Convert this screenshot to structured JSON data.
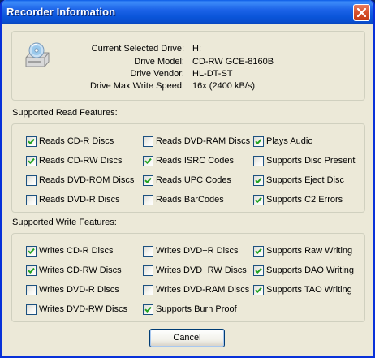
{
  "window": {
    "title": "Recorder Information"
  },
  "drive_info": [
    {
      "label": "Current Selected Drive:",
      "value": "H:"
    },
    {
      "label": "Drive Model:",
      "value": "CD-RW GCE-8160B"
    },
    {
      "label": "Drive Vendor:",
      "value": "HL-DT-ST"
    },
    {
      "label": "Drive Max Write Speed:",
      "value": "16x (2400 kB/s)"
    }
  ],
  "read_section": {
    "label": "Supported Read Features:",
    "items": [
      {
        "label": "Reads CD-R Discs",
        "checked": true
      },
      {
        "label": "Reads CD-RW Discs",
        "checked": true
      },
      {
        "label": "Reads DVD-ROM Discs",
        "checked": false
      },
      {
        "label": "Reads DVD-R Discs",
        "checked": false
      },
      {
        "label": "Reads DVD-RAM Discs",
        "checked": false
      },
      {
        "label": "Reads ISRC Codes",
        "checked": true
      },
      {
        "label": "Reads UPC Codes",
        "checked": true
      },
      {
        "label": "Reads BarCodes",
        "checked": false
      },
      {
        "label": "Plays Audio",
        "checked": true
      },
      {
        "label": "Supports Disc Present",
        "checked": false
      },
      {
        "label": "Supports Eject Disc",
        "checked": true
      },
      {
        "label": "Supports C2 Errors",
        "checked": true
      }
    ]
  },
  "write_section": {
    "label": "Supported Write Features:",
    "items": [
      {
        "label": "Writes CD-R Discs",
        "checked": true
      },
      {
        "label": "Writes CD-RW Discs",
        "checked": true
      },
      {
        "label": "Writes DVD-R Discs",
        "checked": false
      },
      {
        "label": "Writes DVD-RW Discs",
        "checked": false
      },
      {
        "label": "Writes DVD+R Discs",
        "checked": false
      },
      {
        "label": "Writes DVD+RW Discs",
        "checked": false
      },
      {
        "label": "Writes DVD-RAM Discs",
        "checked": false
      },
      {
        "label": "Supports Burn Proof",
        "checked": true
      },
      {
        "label": "Supports Raw Writing",
        "checked": true
      },
      {
        "label": "Supports DAO Writing",
        "checked": true
      },
      {
        "label": "Supports TAO Writing",
        "checked": true
      }
    ]
  },
  "buttons": {
    "cancel_label": "Cancel"
  },
  "icons": {
    "close": "close-icon",
    "drive": "cd-drive-icon",
    "check": "checkmark-icon"
  },
  "colors": {
    "title_bar": "#0a55d9",
    "window_bg": "#ece9d8",
    "check": "#21a121",
    "close_button": "#d9532e"
  }
}
